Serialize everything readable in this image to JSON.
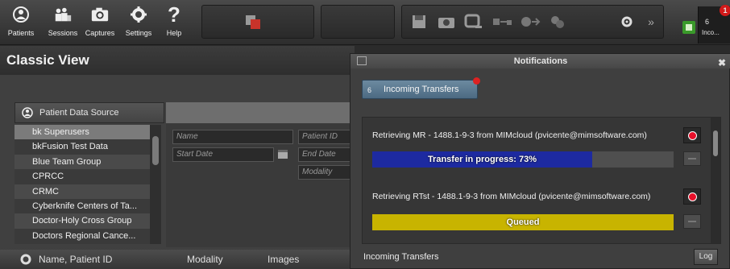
{
  "toolbar": {
    "buttons": [
      {
        "label": "Patients",
        "icon": "patients-icon"
      },
      {
        "label": "Sessions",
        "icon": "sessions-icon"
      },
      {
        "label": "Captures",
        "icon": "captures-icon"
      },
      {
        "label": "Settings",
        "icon": "settings-icon"
      },
      {
        "label": "Help",
        "icon": "help-icon"
      }
    ],
    "incoming": {
      "count": "6",
      "label": "Inco...",
      "badge": "1"
    }
  },
  "view": {
    "title": "Classic View"
  },
  "source": {
    "header": "Patient Data Source",
    "items": [
      "bk Superusers",
      "bkFusion Test Data",
      "Blue Team Group",
      "CPRCC",
      "CRMC",
      "Cyberknife Centers of Ta...",
      "Doctor-Holy Cross Group",
      "Doctors Regional Cance..."
    ]
  },
  "search": {
    "name_placeholder": "Name",
    "patient_id_placeholder": "Patient ID",
    "start_date_placeholder": "Start Date",
    "end_date_placeholder": "End Date",
    "modality_placeholder": "Modality"
  },
  "table": {
    "columns": [
      "Name, Patient ID",
      "Modality",
      "Images"
    ]
  },
  "notifications": {
    "title": "Notifications",
    "tab": {
      "count": "6",
      "label": "Incoming Transfers"
    },
    "transfers": [
      {
        "text": "Retrieving MR - 1488.1-9-3 from MIMcloud (pvicente@mimsoftware.com)",
        "status": "Transfer in progress: 73%",
        "progress": 0.73,
        "bar_color": "#1d2aa0"
      },
      {
        "text": "Retrieving RTst - 1488.1-9-3 from MIMcloud (pvicente@mimsoftware.com)",
        "status": "Queued",
        "progress": 1.0,
        "bar_color": "#c8b400"
      }
    ],
    "footer": "Incoming Transfers",
    "log_button": "Log"
  },
  "colors": {
    "accent": "#e8102a",
    "tab_blue": "#5a7a92"
  }
}
